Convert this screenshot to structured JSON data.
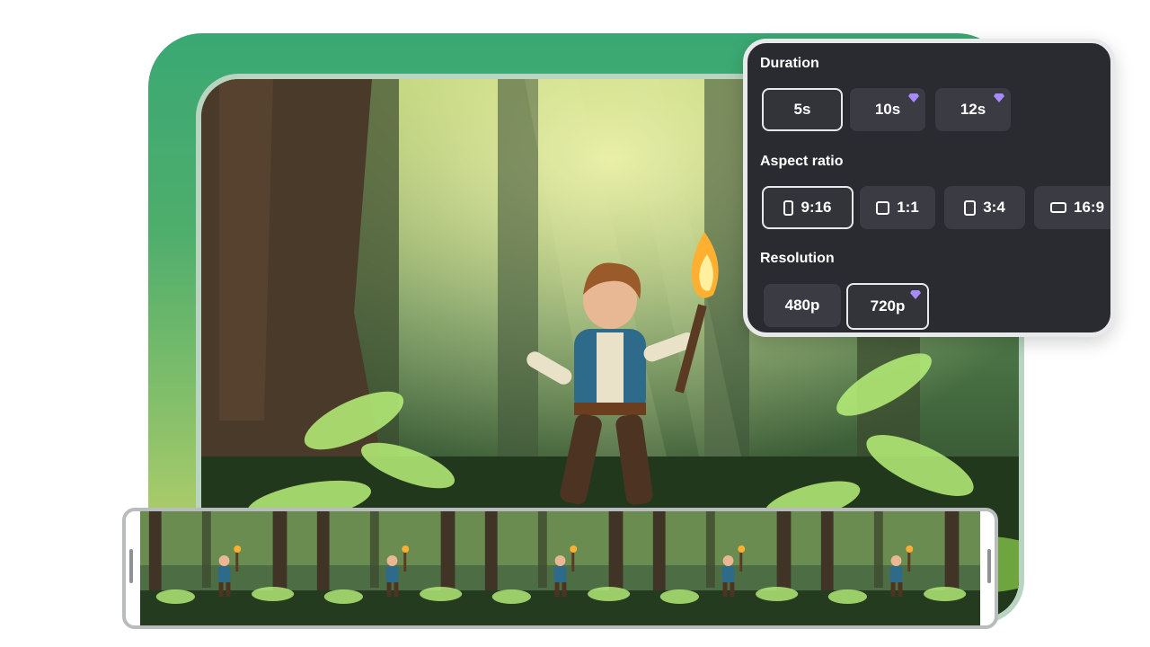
{
  "panel": {
    "duration": {
      "title": "Duration",
      "options": [
        {
          "label": "5s",
          "selected": true,
          "premium": false
        },
        {
          "label": "10s",
          "selected": false,
          "premium": true
        },
        {
          "label": "12s",
          "selected": false,
          "premium": true
        }
      ]
    },
    "aspect_ratio": {
      "title": "Aspect ratio",
      "options": [
        {
          "label": "9:16",
          "selected": true,
          "icon": "portrait-icon"
        },
        {
          "label": "1:1",
          "selected": false,
          "icon": "square-icon"
        },
        {
          "label": "3:4",
          "selected": false,
          "icon": "portrait-icon"
        },
        {
          "label": "16:9",
          "selected": false,
          "icon": "landscape-icon"
        }
      ]
    },
    "resolution": {
      "title": "Resolution",
      "options": [
        {
          "label": "480p",
          "selected": false,
          "premium": false
        },
        {
          "label": "720p",
          "selected": true,
          "premium": true
        }
      ]
    }
  },
  "colors": {
    "backdrop_top": "#3aa873",
    "backdrop_bottom": "#c9d66a",
    "panel_bg": "#2a2b31",
    "option_bg": "#3b3c43",
    "premium_gem": "#a78bfa"
  },
  "filmstrip": {
    "frame_count": 5
  }
}
